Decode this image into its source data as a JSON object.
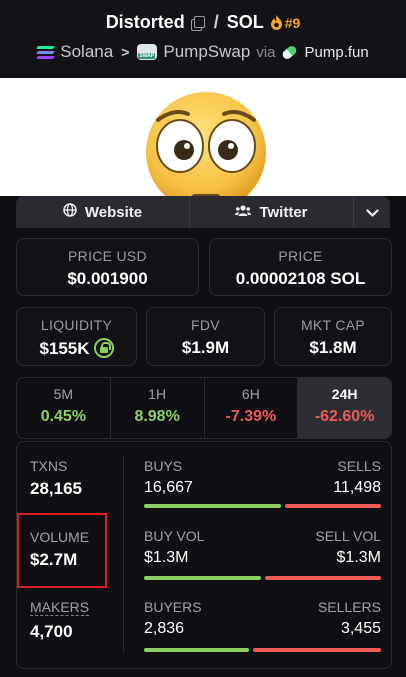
{
  "header": {
    "token_name": "Distorted",
    "quote": "SOL",
    "rank": "#9",
    "chain": "Solana",
    "dex": "PumpSwap",
    "via": "via",
    "launchpad": "Pump.fun"
  },
  "links": {
    "website": "Website",
    "twitter": "Twitter"
  },
  "price": {
    "usd_label": "PRICE USD",
    "usd_value": "$0.001900",
    "native_label": "PRICE",
    "native_value": "0.00002108 SOL"
  },
  "metrics": {
    "liquidity_label": "LIQUIDITY",
    "liquidity_value": "$155K",
    "fdv_label": "FDV",
    "fdv_value": "$1.9M",
    "mcap_label": "MKT CAP",
    "mcap_value": "$1.8M"
  },
  "timeframes": [
    {
      "label": "5M",
      "value": "0.45%"
    },
    {
      "label": "1H",
      "value": "8.98%"
    },
    {
      "label": "6H",
      "value": "-7.39%"
    },
    {
      "label": "24H",
      "value": "-62.60%"
    }
  ],
  "stats": {
    "txns_label": "TXNS",
    "txns_value": "28,165",
    "volume_label": "VOLUME",
    "volume_value": "$2.7M",
    "makers_label": "MAKERS",
    "makers_value": "4,700",
    "buys_label": "BUYS",
    "buys_value": "16,667",
    "sells_label": "SELLS",
    "sells_value": "11,498",
    "buy_ratio": 0.59,
    "buyvol_label": "BUY VOL",
    "buyvol_value": "$1.3M",
    "sellvol_label": "SELL VOL",
    "sellvol_value": "$1.3M",
    "buyvol_ratio": 0.5,
    "buyers_label": "BUYERS",
    "buyers_value": "2,836",
    "sellers_label": "SELLERS",
    "sellers_value": "3,455",
    "buyers_ratio": 0.45
  },
  "colors": {
    "positive": "#8fce63",
    "negative": "#ef5a5a",
    "highlight": "#d9201f",
    "rank": "#f5a524"
  }
}
